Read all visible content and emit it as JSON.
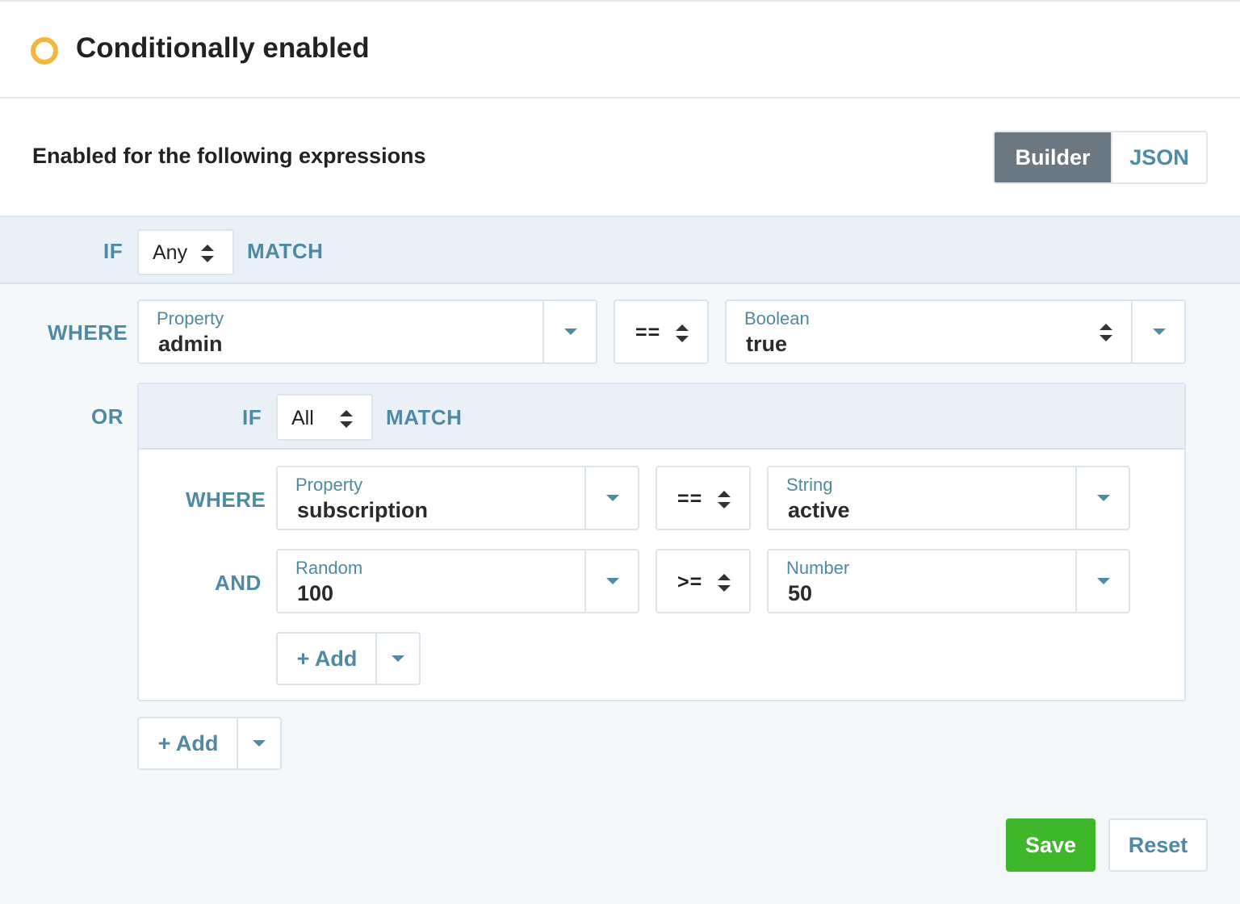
{
  "header": {
    "title": "Conditionally enabled",
    "status_color": "#f2b83d"
  },
  "subheader": {
    "title": "Enabled for the following expressions",
    "modes": [
      "Builder",
      "JSON"
    ],
    "active_mode": "Builder"
  },
  "root": {
    "if_label": "IF",
    "match_mode": "Any",
    "match_label": "MATCH",
    "where_label": "WHERE",
    "or_label": "OR",
    "rule": {
      "left_type": "Property",
      "left_value": "admin",
      "operator": "==",
      "right_type": "Boolean",
      "right_value": "true"
    },
    "add_label": "+ Add"
  },
  "group": {
    "if_label": "IF",
    "match_mode": "All",
    "match_label": "MATCH",
    "rules": [
      {
        "joiner": "WHERE",
        "left_type": "Property",
        "left_value": "subscription",
        "operator": "==",
        "right_type": "String",
        "right_value": "active"
      },
      {
        "joiner": "AND",
        "left_type": "Random",
        "left_value": "100",
        "operator": ">=",
        "right_type": "Number",
        "right_value": "50"
      }
    ],
    "add_label": "+ Add"
  },
  "footer": {
    "save_label": "Save",
    "reset_label": "Reset",
    "save_color": "#3eb82a"
  },
  "colors": {
    "accent": "#4e8aa2",
    "toggle_active_bg": "#6b7882"
  }
}
